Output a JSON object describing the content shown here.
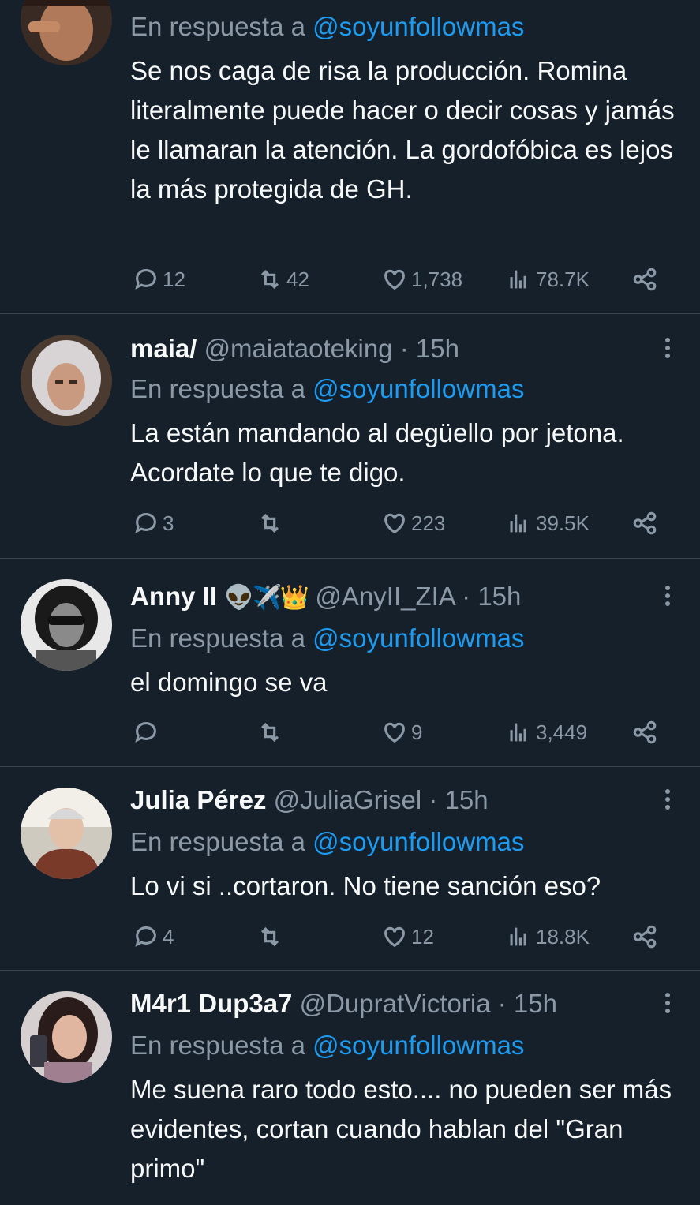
{
  "tweets": [
    {
      "name": "",
      "handle": "",
      "time": "",
      "reply_prefix": "En respuesta a",
      "reply_to": "@soyunfollowmas",
      "text": "Se nos caga de risa la producción. Romina literalmente puede hacer o decir cosas y jamás le llamaran la atención. La gordofóbica es lejos la más protegida de GH.",
      "replies": "12",
      "retweets": "42",
      "likes": "1,738",
      "views": "78.7K"
    },
    {
      "name": "maia/",
      "handle": "@maiataoteking",
      "time": "· 15h",
      "reply_prefix": "En respuesta a",
      "reply_to": "@soyunfollowmas",
      "text": "La están mandando al degüello por jetona. Acordate lo que te digo.",
      "replies": "3",
      "retweets": "",
      "likes": "223",
      "views": "39.5K"
    },
    {
      "name": "Anny II",
      "emoji": "👽✈️👑",
      "handle": "@AnyII_ZIA",
      "time": "· 15h",
      "reply_prefix": "En respuesta a",
      "reply_to": "@soyunfollowmas",
      "text": "el domingo se va",
      "replies": "",
      "retweets": "",
      "likes": "9",
      "views": "3,449"
    },
    {
      "name": "Julia Pérez",
      "handle": "@JuliaGrisel",
      "time": "· 15h",
      "reply_prefix": "En respuesta a",
      "reply_to": "@soyunfollowmas",
      "text": "Lo vi si ..cortaron. No tiene sanción eso?",
      "replies": "4",
      "retweets": "",
      "likes": "12",
      "views": "18.8K"
    },
    {
      "name": "M4r1 Dup3a7",
      "handle": "@DupratVictoria",
      "time": "· 15h",
      "reply_prefix": "En respuesta a",
      "reply_to": "@soyunfollowmas",
      "text": "Me suena raro todo esto.... no pueden ser más evidentes, cortan cuando hablan del \"Gran primo\""
    }
  ],
  "colors": {
    "background": "#15202b",
    "text": "#f7f9f9",
    "muted": "#8b98a5",
    "link": "#1d9bf0",
    "divider": "#38444d"
  },
  "icons": [
    "reply-icon",
    "retweet-icon",
    "like-icon",
    "views-icon",
    "share-icon",
    "more-options-icon"
  ]
}
